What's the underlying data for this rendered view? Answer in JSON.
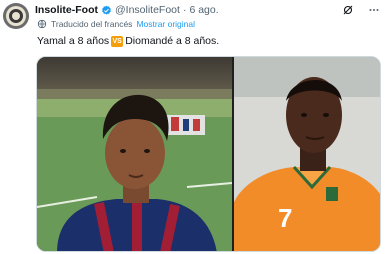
{
  "tweet": {
    "author_name": "Insolite-Foot",
    "handle": "@InsoliteFoot",
    "separator": "·",
    "date": "6 ago.",
    "translation_note": "Traducido del francés",
    "show_original_label": "Mostrar original",
    "text_before": "Yamal a 8 años",
    "emoji_label": "VS",
    "text_after": "Diomandé a 8 años.",
    "icons": {
      "verified": "verified-badge-icon",
      "translate": "translate-globe-icon",
      "grok": "grok-icon",
      "more": "more-options-icon"
    },
    "colors": {
      "link": "#1d9bf0",
      "secondary_text": "#536471",
      "primary_text": "#0f1419",
      "emoji_bg": "#f59e0b",
      "jersey_orange": "#f28c28"
    }
  }
}
